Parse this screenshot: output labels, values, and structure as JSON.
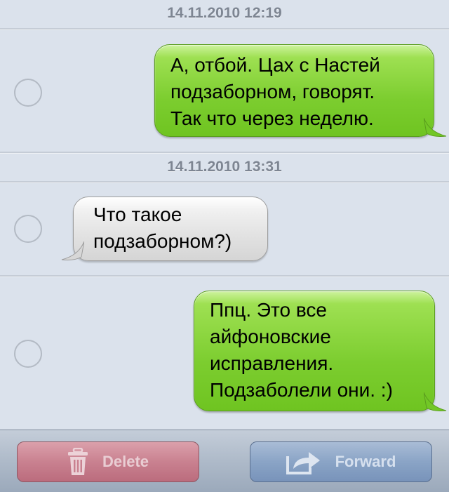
{
  "thread": {
    "timestamps": [
      "14.11.2010 12:19",
      "14.11.2010 13:31"
    ],
    "messages": [
      {
        "direction": "outgoing",
        "lines": [
          "А, отбой. Цах с Настей",
          "подзаборном, говорят.",
          "Так что через неделю."
        ]
      },
      {
        "direction": "incoming",
        "lines": [
          "Что такое",
          "подзаборном?)"
        ]
      },
      {
        "direction": "outgoing",
        "lines": [
          "Ппц. Это все",
          "айфоновские",
          "исправления.",
          "Подзаболели они. :)"
        ]
      }
    ]
  },
  "toolbar": {
    "delete_label": "Delete",
    "forward_label": "Forward",
    "delete_icon": "trash-icon",
    "forward_icon": "forward-arrow-icon"
  },
  "colors": {
    "background": "#dbe2ec",
    "outgoing_bubble": "#8ed53f",
    "incoming_bubble": "#e6e6e6",
    "delete_button": "#c98190",
    "forward_button": "#8aa4c6"
  }
}
